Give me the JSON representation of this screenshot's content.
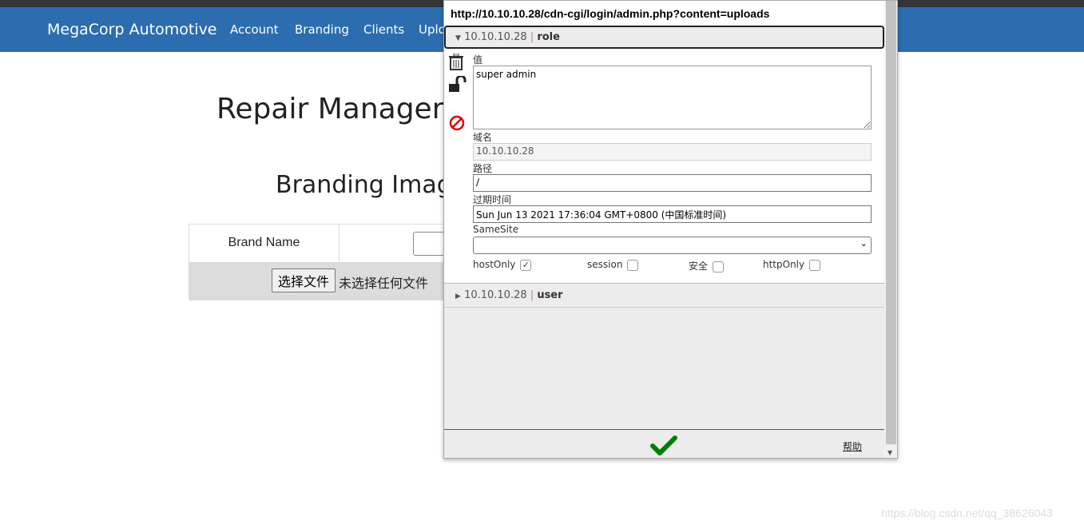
{
  "site": {
    "brand": "MegaCorp Automotive",
    "nav": [
      "Account",
      "Branding",
      "Clients",
      "Uplo"
    ]
  },
  "main": {
    "title": "Repair Manager",
    "subtitle": "Branding Imag",
    "brand_label": "Brand Name",
    "file_button": "选择文件",
    "file_status": "未选择任何文件"
  },
  "cookie_editor": {
    "url": "http://10.10.10.28/cdn-cgi/login/admin.php?content=uploads",
    "cookies": [
      {
        "domain": "10.10.10.28",
        "name": "role",
        "expanded": true
      },
      {
        "domain": "10.10.10.28",
        "name": "user",
        "expanded": false
      }
    ],
    "separator": "|",
    "value_label": "值",
    "value": "super admin",
    "domain_label": "域名",
    "domain": "10.10.10.28",
    "path_label": "路径",
    "path": "/",
    "expires_label": "过期时间",
    "expires": "Sun Jun 13 2021 17:36:04 GMT+0800 (中国标准时间)",
    "samesite_label": "SameSite",
    "samesite": "",
    "flags": [
      {
        "label": "hostOnly",
        "checked": true
      },
      {
        "label": "session",
        "checked": false
      },
      {
        "label": "安全",
        "checked": false
      },
      {
        "label": "httpOnly",
        "checked": false
      }
    ],
    "help": "帮助",
    "colors": {
      "confirm": "#008000",
      "delete_blocked": "#e00000"
    }
  },
  "watermark": "https://blog.csdn.net/qq_38626043"
}
